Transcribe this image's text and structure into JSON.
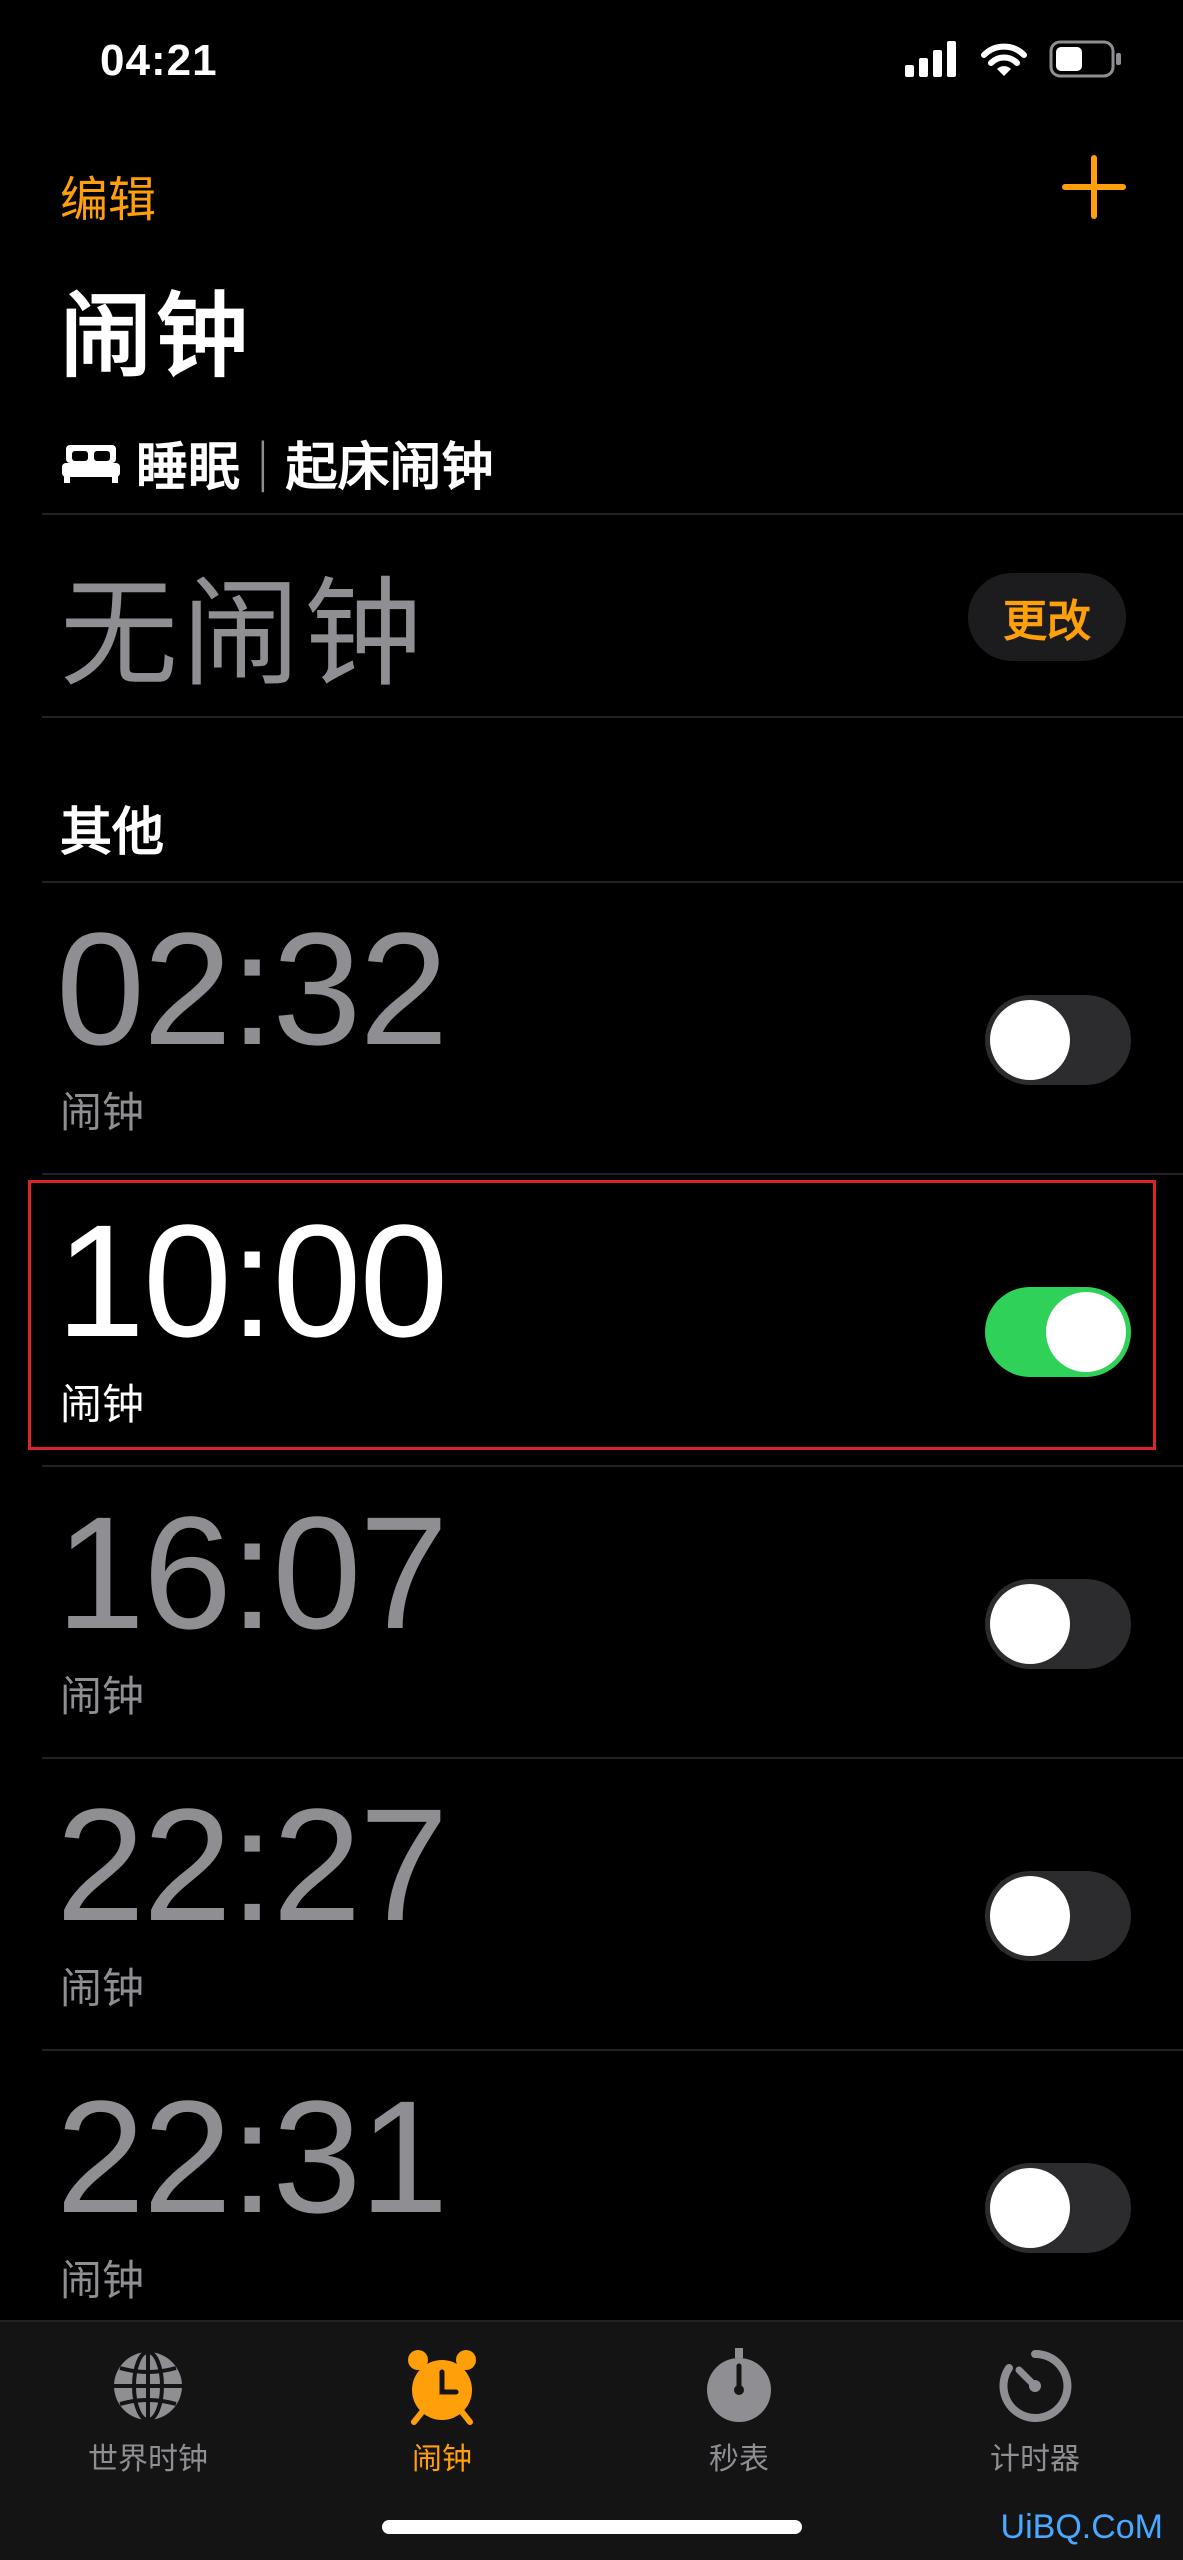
{
  "status_bar": {
    "time": "04:21"
  },
  "header": {
    "edit_label": "编辑",
    "title": "闹钟"
  },
  "sleep": {
    "title_left": "睡眠",
    "separator": "|",
    "title_right": "起床闹钟",
    "status": "无闹钟",
    "change_label": "更改"
  },
  "other": {
    "section_title": "其他"
  },
  "alarms": [
    {
      "time": "02:32",
      "label": "闹钟",
      "enabled": false
    },
    {
      "time": "10:00",
      "label": "闹钟",
      "enabled": true
    },
    {
      "time": "16:07",
      "label": "闹钟",
      "enabled": false
    },
    {
      "time": "22:27",
      "label": "闹钟",
      "enabled": false
    },
    {
      "time": "22:31",
      "label": "闹钟",
      "enabled": false
    }
  ],
  "tabs": [
    {
      "label": "世界时钟",
      "icon": "globe-icon",
      "active": false
    },
    {
      "label": "闹钟",
      "icon": "alarm-clock-icon",
      "active": true
    },
    {
      "label": "秒表",
      "icon": "stopwatch-icon",
      "active": false
    },
    {
      "label": "计时器",
      "icon": "timer-icon",
      "active": false
    }
  ],
  "watermark": "UiBQ.CoM",
  "colors": {
    "accent": "#ff9f0a",
    "toggle_on": "#30d158",
    "toggle_off": "#2c2c2e",
    "inactive_text": "#8e8e93",
    "highlight": "#d8242a"
  }
}
